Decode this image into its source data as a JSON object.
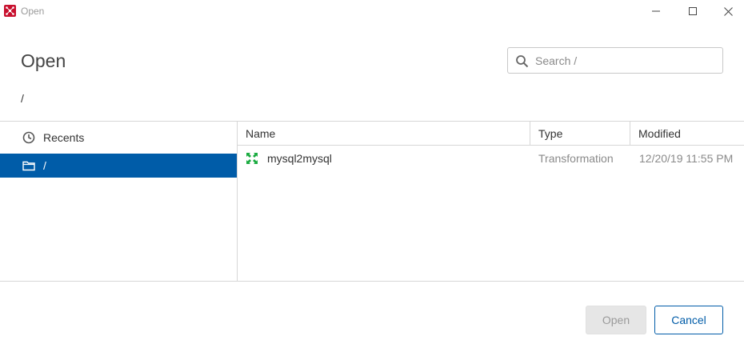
{
  "window": {
    "title": "Open",
    "icon": "pentaho-spoon-icon"
  },
  "header": {
    "title": "Open",
    "breadcrumb": "/"
  },
  "search": {
    "placeholder": "Search /",
    "value": ""
  },
  "sidebar": {
    "items": [
      {
        "label": "Recents",
        "icon": "clock-icon",
        "selected": false
      },
      {
        "label": "/",
        "icon": "folder-icon",
        "selected": true
      }
    ]
  },
  "filelist": {
    "columns": [
      "Name",
      "Type",
      "Modified"
    ],
    "rows": [
      {
        "name": "mysql2mysql",
        "type": "Transformation",
        "modified": "12/20/19 11:55 PM",
        "icon": "transformation-icon"
      }
    ]
  },
  "footer": {
    "open_label": "Open",
    "cancel_label": "Cancel"
  },
  "colors": {
    "accent": "#005ca8",
    "selected_bg": "#005ca8",
    "icon_green": "#1aab40",
    "app_red": "#c8102e"
  }
}
